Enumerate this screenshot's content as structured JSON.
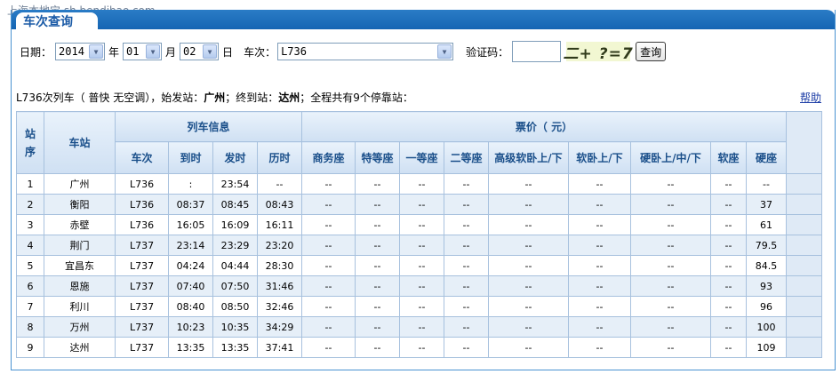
{
  "watermark": "上海本地宝 sh.bendibao.com",
  "header": {
    "title": "车次查询"
  },
  "form": {
    "date_label": "日期：",
    "year_value": "2014",
    "year_suffix": "年",
    "month_value": "01",
    "month_suffix": "月",
    "day_value": "02",
    "day_suffix": "日",
    "train_label": "车次：",
    "train_value": "L736",
    "captcha_label": "验证码：",
    "captcha_input_value": "",
    "captcha_image_text": "二+ ?=7",
    "query_button": "查询"
  },
  "summary": {
    "prefix": "L736次列车（ 普快  无空调），始发站：",
    "origin": "广州",
    "mid": "；终到站：",
    "destination": "达州",
    "suffix": "；全程共有9个停靠站："
  },
  "help_label": "帮助",
  "table": {
    "group_headers": {
      "stop_no": "站序",
      "station": "车站",
      "train_info": "列车信息",
      "fare": "票价（ 元）"
    },
    "info_columns": [
      "车次",
      "到时",
      "发时",
      "历时"
    ],
    "fare_columns": [
      "商务座",
      "特等座",
      "一等座",
      "二等座",
      "高级软卧上/下",
      "软卧上/下",
      "硬卧上/中/下",
      "软座",
      "硬座"
    ],
    "rows": [
      [
        "1",
        "广州",
        "L736",
        ":",
        "23:54",
        "--",
        "--",
        "--",
        "--",
        "--",
        "--",
        "--",
        "--",
        "--",
        "--"
      ],
      [
        "2",
        "衡阳",
        "L736",
        "08:37",
        "08:45",
        "08:43",
        "--",
        "--",
        "--",
        "--",
        "--",
        "--",
        "--",
        "--",
        "37"
      ],
      [
        "3",
        "赤壁",
        "L736",
        "16:05",
        "16:09",
        "16:11",
        "--",
        "--",
        "--",
        "--",
        "--",
        "--",
        "--",
        "--",
        "61"
      ],
      [
        "4",
        "荆门",
        "L737",
        "23:14",
        "23:29",
        "23:20",
        "--",
        "--",
        "--",
        "--",
        "--",
        "--",
        "--",
        "--",
        "79.5"
      ],
      [
        "5",
        "宜昌东",
        "L737",
        "04:24",
        "04:44",
        "28:30",
        "--",
        "--",
        "--",
        "--",
        "--",
        "--",
        "--",
        "--",
        "84.5"
      ],
      [
        "6",
        "恩施",
        "L737",
        "07:40",
        "07:50",
        "31:46",
        "--",
        "--",
        "--",
        "--",
        "--",
        "--",
        "--",
        "--",
        "93"
      ],
      [
        "7",
        "利川",
        "L737",
        "08:40",
        "08:50",
        "32:46",
        "--",
        "--",
        "--",
        "--",
        "--",
        "--",
        "--",
        "--",
        "96"
      ],
      [
        "8",
        "万州",
        "L737",
        "10:23",
        "10:35",
        "34:29",
        "--",
        "--",
        "--",
        "--",
        "--",
        "--",
        "--",
        "--",
        "100"
      ],
      [
        "9",
        "达州",
        "L737",
        "13:35",
        "13:35",
        "37:41",
        "--",
        "--",
        "--",
        "--",
        "--",
        "--",
        "--",
        "--",
        "109"
      ]
    ]
  },
  "colors": {
    "header_bar": "#1a6bb8",
    "title": "#1a5aa6",
    "link": "#1e3ea6",
    "row_alt": "#e6eff8",
    "border": "#a7c1de"
  }
}
